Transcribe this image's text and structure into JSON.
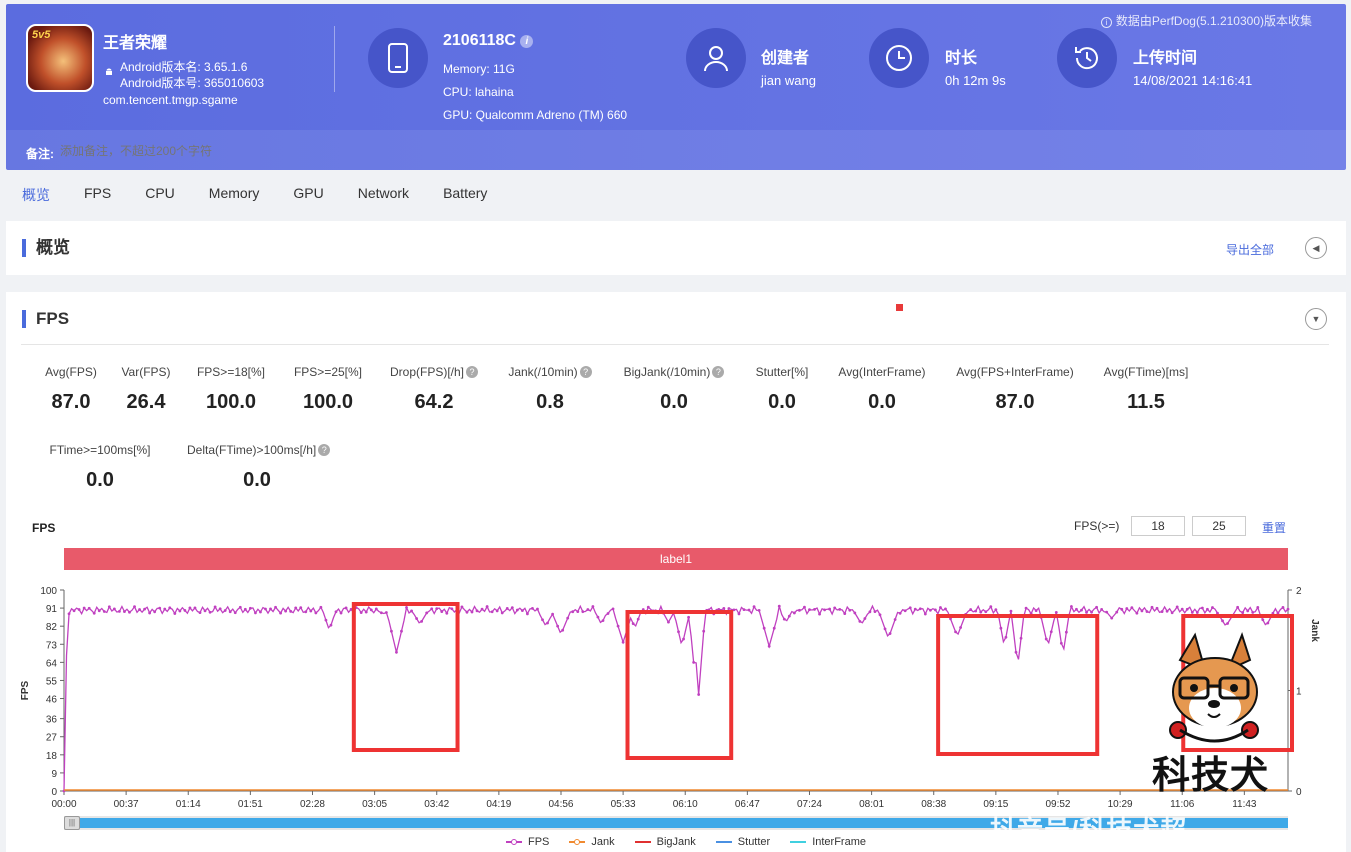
{
  "header": {
    "app_name": "王者荣耀",
    "app_icon_badge": "5v5",
    "android_version_name": "Android版本名: 3.65.1.6",
    "android_version_code": "Android版本号: 365010603",
    "package": "com.tencent.tmgp.sgame",
    "device": {
      "name": "2106118C",
      "memory": "Memory: 11G",
      "cpu": "CPU: lahaina",
      "gpu": "GPU: Qualcomm Adreno (TM) 660"
    },
    "creator": {
      "title": "创建者",
      "value": "jian wang"
    },
    "duration": {
      "title": "时长",
      "value": "0h 12m 9s"
    },
    "upload": {
      "title": "上传时间",
      "value": "14/08/2021 14:16:41"
    },
    "source_note": "数据由PerfDog(5.1.210300)版本收集",
    "note_label": "备注:",
    "note_placeholder": "添加备注，不超过200个字符"
  },
  "tabs": [
    "概览",
    "FPS",
    "CPU",
    "Memory",
    "GPU",
    "Network",
    "Battery"
  ],
  "overview": {
    "title": "概览",
    "export_label": "导出全部"
  },
  "fps_section": {
    "title": "FPS",
    "metrics_row1": [
      {
        "label": "Avg(FPS)",
        "value": "87.0",
        "help": false
      },
      {
        "label": "Var(FPS)",
        "value": "26.4",
        "help": false
      },
      {
        "label": "FPS>=18[%]",
        "value": "100.0",
        "help": false
      },
      {
        "label": "FPS>=25[%]",
        "value": "100.0",
        "help": false
      },
      {
        "label": "Drop(FPS)[/h]",
        "value": "64.2",
        "help": true
      },
      {
        "label": "Jank(/10min)",
        "value": "0.8",
        "help": true
      },
      {
        "label": "BigJank(/10min)",
        "value": "0.0",
        "help": true
      },
      {
        "label": "Stutter[%]",
        "value": "0.0",
        "help": false
      },
      {
        "label": "Avg(InterFrame)",
        "value": "0.0",
        "help": false
      },
      {
        "label": "Avg(FPS+InterFrame)",
        "value": "87.0",
        "help": false
      },
      {
        "label": "Avg(FTime)[ms]",
        "value": "11.5",
        "help": false
      }
    ],
    "metrics_row2": [
      {
        "label": "FTime>=100ms[%]",
        "value": "0.0",
        "help": false
      },
      {
        "label": "Delta(FTime)>100ms[/h]",
        "value": "0.0",
        "help": true
      }
    ],
    "chart_label": "FPS",
    "threshold_label": "FPS(>=)",
    "threshold_1": "18",
    "threshold_2": "25",
    "reset_label": "重置"
  },
  "chart_data": {
    "type": "line",
    "title": "FPS",
    "band_label": "label1",
    "ylabel": "FPS",
    "y2label": "Jank",
    "ylim": [
      0,
      100
    ],
    "y2lim": [
      0,
      2
    ],
    "yticks": [
      0,
      9,
      18,
      27,
      36,
      46,
      55,
      64,
      73,
      82,
      91,
      100
    ],
    "y2ticks": [
      0,
      1,
      2
    ],
    "xticks": [
      "00:00",
      "00:37",
      "01:14",
      "01:51",
      "02:28",
      "03:05",
      "03:42",
      "04:19",
      "04:56",
      "05:33",
      "06:10",
      "06:47",
      "07:24",
      "08:01",
      "08:38",
      "09:15",
      "09:52",
      "10:29",
      "11:06",
      "11:43"
    ],
    "x_max_seconds": 729,
    "series": [
      {
        "name": "FPS",
        "color": "#c040c0",
        "baseline": 90,
        "dips": [
          [
            0,
            0,
            2
          ],
          [
            158,
            80,
            4
          ],
          [
            190,
            88,
            3
          ],
          [
            198,
            69,
            6
          ],
          [
            212,
            83,
            5
          ],
          [
            287,
            82,
            5
          ],
          [
            296,
            78,
            6
          ],
          [
            320,
            83,
            4
          ],
          [
            333,
            74,
            6
          ],
          [
            340,
            81,
            4
          ],
          [
            360,
            84,
            4
          ],
          [
            368,
            72,
            5
          ],
          [
            375,
            64,
            3
          ],
          [
            378,
            48,
            4
          ],
          [
            420,
            72,
            6
          ],
          [
            430,
            84,
            4
          ],
          [
            475,
            83,
            5
          ],
          [
            491,
            76,
            6
          ],
          [
            532,
            77,
            6
          ],
          [
            560,
            72,
            4
          ],
          [
            568,
            62,
            4
          ],
          [
            586,
            72,
            5
          ],
          [
            595,
            68,
            4
          ],
          [
            624,
            86,
            4
          ],
          [
            692,
            82,
            6
          ],
          [
            716,
            82,
            5
          ]
        ]
      },
      {
        "name": "Jank",
        "color": "#f08a30"
      },
      {
        "name": "BigJank",
        "color": "#e03030"
      },
      {
        "name": "Stutter",
        "color": "#4a90e2"
      },
      {
        "name": "InterFrame",
        "color": "#40d0e0"
      }
    ],
    "highlights": [
      [
        175,
        232
      ],
      [
        338,
        395
      ],
      [
        523,
        613
      ],
      [
        669,
        729
      ]
    ],
    "grid": false,
    "legend": "bottom"
  },
  "watermark": {
    "mascot_text": "科技犬",
    "partial_text": "抖音号/科技犬超"
  }
}
